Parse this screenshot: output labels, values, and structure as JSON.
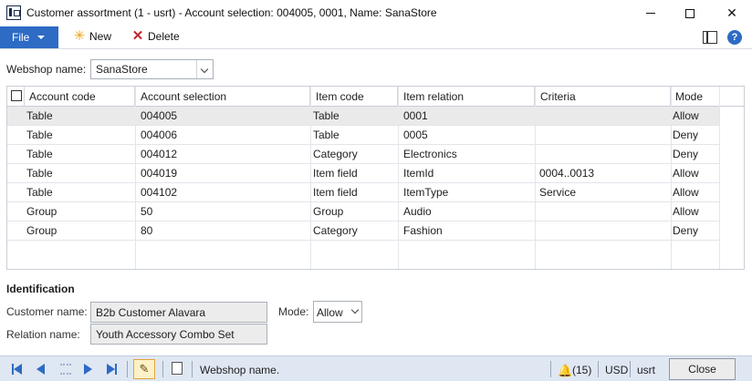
{
  "window": {
    "title": "Customer assortment (1 - usrt) - Account selection: 004005, 0001, Name: SanaStore",
    "minimize": "—",
    "maximize": "☐",
    "close": "✕"
  },
  "actionpane": {
    "file_label": "File",
    "new_label": "New",
    "delete_label": "Delete",
    "help_label": "?"
  },
  "webshop": {
    "label": "Webshop name:",
    "value": "SanaStore"
  },
  "grid": {
    "columns": [
      "Account code",
      "Account selection",
      "Item code",
      "Item relation",
      "Criteria",
      "Mode"
    ],
    "rows": [
      [
        "Table",
        "004005",
        "Table",
        "0001",
        "",
        "Allow"
      ],
      [
        "Table",
        "004006",
        "Table",
        "0005",
        "",
        "Deny"
      ],
      [
        "Table",
        "004012",
        "Category",
        "Electronics",
        "",
        "Deny"
      ],
      [
        "Table",
        "004019",
        "Item field",
        "ItemId",
        "0004..0013",
        "Allow"
      ],
      [
        "Table",
        "004102",
        "Item field",
        "ItemType",
        "Service",
        "Allow"
      ],
      [
        "Group",
        "50",
        "Group",
        "Audio",
        "",
        "Allow"
      ],
      [
        "Group",
        "80",
        "Category",
        "Fashion",
        "",
        "Deny"
      ]
    ],
    "selected_row": 0
  },
  "identification": {
    "title": "Identification",
    "customer_name_label": "Customer name:",
    "customer_name_value": "B2b Customer Alavara",
    "relation_name_label": "Relation name:",
    "relation_name_value": "Youth Accessory Combo Set",
    "mode_label": "Mode:",
    "mode_value": "Allow"
  },
  "statusbar": {
    "help_text": "Webshop name.",
    "notifications": "(15)",
    "currency": "USD",
    "company": "usrt",
    "close_label": "Close"
  },
  "colors": {
    "accent": "#2d6bc4",
    "statusbar_bg": "#dfe7f3",
    "selected_row": "#eaeaea"
  }
}
